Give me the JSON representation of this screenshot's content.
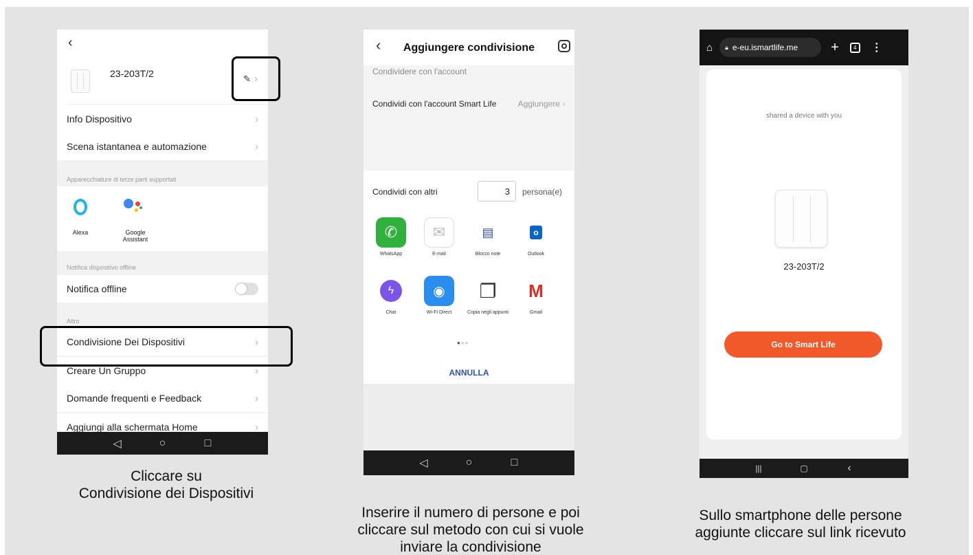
{
  "phone1": {
    "back_icon": "chevron-left-icon",
    "device_name": "23-203T/2",
    "rows": {
      "info": "Info Dispositivo",
      "scene": "Scena istantanea e automazione",
      "offline": "Notifica offline",
      "sharing": "Condivisione Dei Dispositivi",
      "group": "Creare Un Gruppo",
      "faq": "Domande frequenti e Feedback",
      "home": "Aggiungi alla schermata Home"
    },
    "labels": {
      "third_party": "Apparecchiature di terze parti supportati",
      "offline_section": "Notifica dispositivo offline",
      "other": "Altro"
    },
    "assistants": {
      "alexa": "Alexa",
      "google": "Google Assistant"
    },
    "caption": [
      "Cliccare su",
      "Condivisione dei Dispositivi"
    ]
  },
  "phone2": {
    "title": "Aggiungere condivisione",
    "section_label": "Condividere con l'account",
    "account_row": "Condividi con l'account Smart Life",
    "add_label": "Aggiungere",
    "share_others": "Condividi con altri",
    "count": "3",
    "count_unit": "persona(e)",
    "apps": [
      "WhatsApp",
      "E-mail",
      "Blocco note",
      "Outlook",
      "Chat",
      "Wi-Fi Direct",
      "Copia negli appunti",
      "Gmail"
    ],
    "cancel": "ANNULLA",
    "caption": [
      "Inserire il numero di persone e poi",
      "cliccare sul metodo con cui si vuole",
      "inviare la condivisione"
    ]
  },
  "phone3": {
    "url": "e-eu.ismartlife.me",
    "tab_count": "4",
    "shared_text": "shared a device with you",
    "device_name": "23-203T/2",
    "button": "Go to Smart Life",
    "caption": [
      "Sullo smartphone delle persone",
      "aggiunte cliccare sul link ricevuto"
    ]
  },
  "colors": {
    "accent_orange": "#f25a2b",
    "link_blue": "#2f50b4",
    "navbar": "#1b1b1b"
  }
}
